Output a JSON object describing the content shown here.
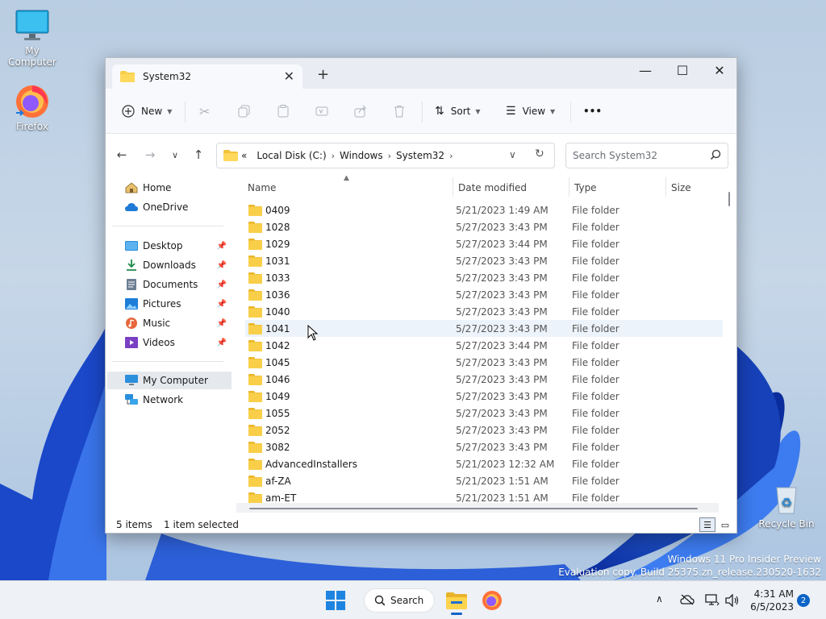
{
  "desktop": {
    "icons": [
      {
        "label": "My Computer"
      },
      {
        "label": "Firefox"
      },
      {
        "label": "Recycle Bin"
      }
    ],
    "watermark_line1": "Windows 11 Pro Insider Preview",
    "watermark_line2": "Evaluation copy. Build 25375.zn_release.230520-1632"
  },
  "window": {
    "tab_title": "System32",
    "new_tab_symbol": "+",
    "controls": {
      "minimize": "—",
      "maximize": "☐",
      "close": "✕"
    },
    "commandbar": {
      "new_label": "New",
      "sort_label": "Sort",
      "view_label": "View",
      "more_label": "•••"
    },
    "address": {
      "overflow": "«",
      "segments": [
        "Local Disk (C:)",
        "Windows",
        "System32"
      ]
    },
    "search": {
      "placeholder": "Search System32"
    },
    "sidebar": {
      "home": "Home",
      "onedrive": "OneDrive",
      "desktop": "Desktop",
      "downloads": "Downloads",
      "documents": "Documents",
      "pictures": "Pictures",
      "music": "Music",
      "videos": "Videos",
      "mycomputer": "My Computer",
      "network": "Network"
    },
    "columns": {
      "name": "Name",
      "date": "Date modified",
      "type": "Type",
      "size": "Size"
    },
    "rows": [
      {
        "name": "0409",
        "date": "5/21/2023 1:49 AM",
        "type": "File folder"
      },
      {
        "name": "1028",
        "date": "5/27/2023 3:43 PM",
        "type": "File folder"
      },
      {
        "name": "1029",
        "date": "5/27/2023 3:44 PM",
        "type": "File folder"
      },
      {
        "name": "1031",
        "date": "5/27/2023 3:43 PM",
        "type": "File folder"
      },
      {
        "name": "1033",
        "date": "5/27/2023 3:43 PM",
        "type": "File folder"
      },
      {
        "name": "1036",
        "date": "5/27/2023 3:43 PM",
        "type": "File folder"
      },
      {
        "name": "1040",
        "date": "5/27/2023 3:43 PM",
        "type": "File folder"
      },
      {
        "name": "1041",
        "date": "5/27/2023 3:43 PM",
        "type": "File folder"
      },
      {
        "name": "1042",
        "date": "5/27/2023 3:44 PM",
        "type": "File folder"
      },
      {
        "name": "1045",
        "date": "5/27/2023 3:43 PM",
        "type": "File folder"
      },
      {
        "name": "1046",
        "date": "5/27/2023 3:43 PM",
        "type": "File folder"
      },
      {
        "name": "1049",
        "date": "5/27/2023 3:43 PM",
        "type": "File folder"
      },
      {
        "name": "1055",
        "date": "5/27/2023 3:43 PM",
        "type": "File folder"
      },
      {
        "name": "2052",
        "date": "5/27/2023 3:43 PM",
        "type": "File folder"
      },
      {
        "name": "3082",
        "date": "5/27/2023 3:43 PM",
        "type": "File folder"
      },
      {
        "name": "AdvancedInstallers",
        "date": "5/21/2023 12:32 AM",
        "type": "File folder"
      },
      {
        "name": "af-ZA",
        "date": "5/21/2023 1:51 AM",
        "type": "File folder"
      },
      {
        "name": "am-ET",
        "date": "5/21/2023 1:51 AM",
        "type": "File folder"
      }
    ],
    "status": {
      "items": "5 items",
      "selected": "1 item selected"
    }
  },
  "taskbar": {
    "search_label": "Search",
    "time": "4:31 AM",
    "date": "6/5/2023",
    "notification_count": "2"
  },
  "colors": {
    "accent": "#0b63c7",
    "folder": "#f9cf4a",
    "hover_row": "#edf3fb"
  }
}
